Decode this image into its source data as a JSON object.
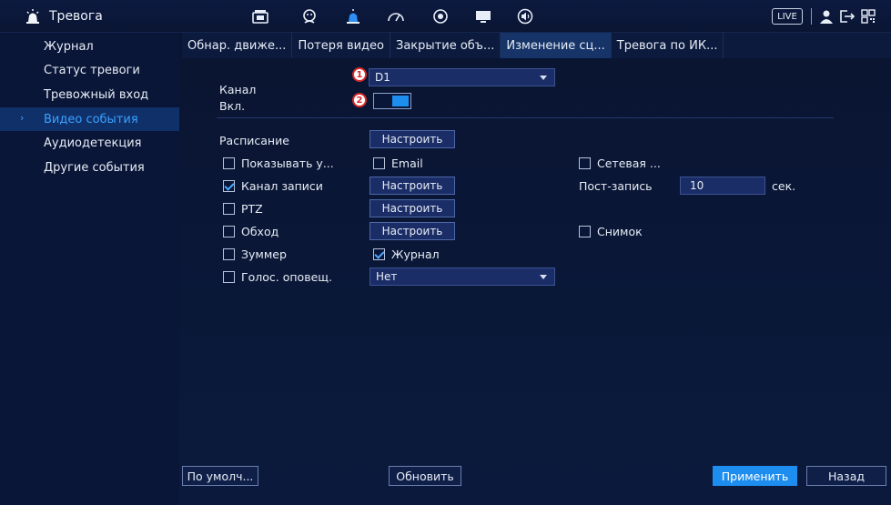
{
  "header": {
    "title": "Тревога",
    "live_label": "LIVE",
    "icons": [
      "siren-icon",
      "camera-icon",
      "face-icon",
      "alarm-icon",
      "speedometer-icon",
      "target-icon",
      "monitor-icon",
      "speaker-icon",
      "user-icon",
      "logout-icon",
      "qr-code-icon"
    ]
  },
  "sidebar": {
    "items": [
      {
        "label": "Журнал"
      },
      {
        "label": "Статус тревоги"
      },
      {
        "label": "Тревожный вход"
      },
      {
        "label": "Видео события"
      },
      {
        "label": "Аудиодетекция"
      },
      {
        "label": "Другие события"
      }
    ],
    "active_index": 3
  },
  "tabs": [
    {
      "label": "Обнар. движе..."
    },
    {
      "label": "Потеря видео"
    },
    {
      "label": "Закрытие объ..."
    },
    {
      "label": "Изменение сц..."
    },
    {
      "label": "Тревога по ИК..."
    }
  ],
  "active_tab": 3,
  "form": {
    "channel_label": "Канал",
    "channel_value": "D1",
    "enable_label": "Вкл.",
    "enable_on": true,
    "badge1": "1",
    "badge2": "2",
    "schedule_label": "Расписание",
    "configure_label": "Настроить",
    "show_msg_label": "Показывать у...",
    "email_label": "Email",
    "network_label": "Сетевая ...",
    "record_channel_label": "Канал записи",
    "post_record_label": "Пост-запись",
    "post_record_value": "10",
    "post_record_unit": "сек.",
    "ptz_label": "PTZ",
    "tour_label": "Обход",
    "snapshot_label": "Снимок",
    "buzzer_label": "Зуммер",
    "log_label": "Журнал",
    "voice_label": "Голос. оповещ.",
    "voice_value": "Нет",
    "checks": {
      "show_msg": false,
      "email": false,
      "network": false,
      "record_channel": true,
      "ptz": false,
      "tour": false,
      "snapshot": false,
      "buzzer": false,
      "log": true,
      "voice": false
    }
  },
  "footer": {
    "default_label": "По умолч...",
    "refresh_label": "Обновить",
    "apply_label": "Применить",
    "back_label": "Назад"
  },
  "colors": {
    "accent": "#1e8df0",
    "active_text": "#3aa1ff",
    "badge_red": "#d42a2a"
  }
}
